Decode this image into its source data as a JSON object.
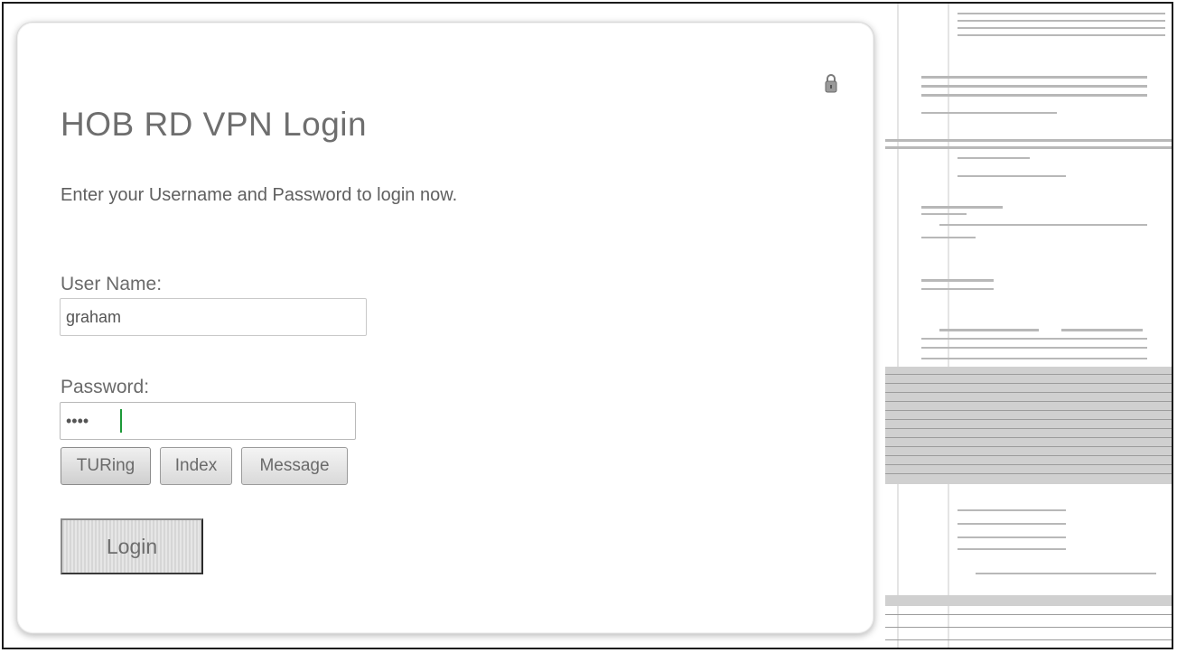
{
  "login": {
    "title": "HOB RD VPN Login",
    "subtitle": "Enter your Username and Password to login now.",
    "username_label": "User Name:",
    "username_value": "graham",
    "password_label": "Password:",
    "password_value": "••••",
    "buttons": {
      "turing": "TURing",
      "index": "Index",
      "message": "Message"
    },
    "login_button": "Login"
  },
  "icons": {
    "lock": "lock-icon"
  },
  "colors": {
    "text": "#6e6e6e",
    "panel_border": "#d8d8d8",
    "caret": "#1c9a38"
  }
}
